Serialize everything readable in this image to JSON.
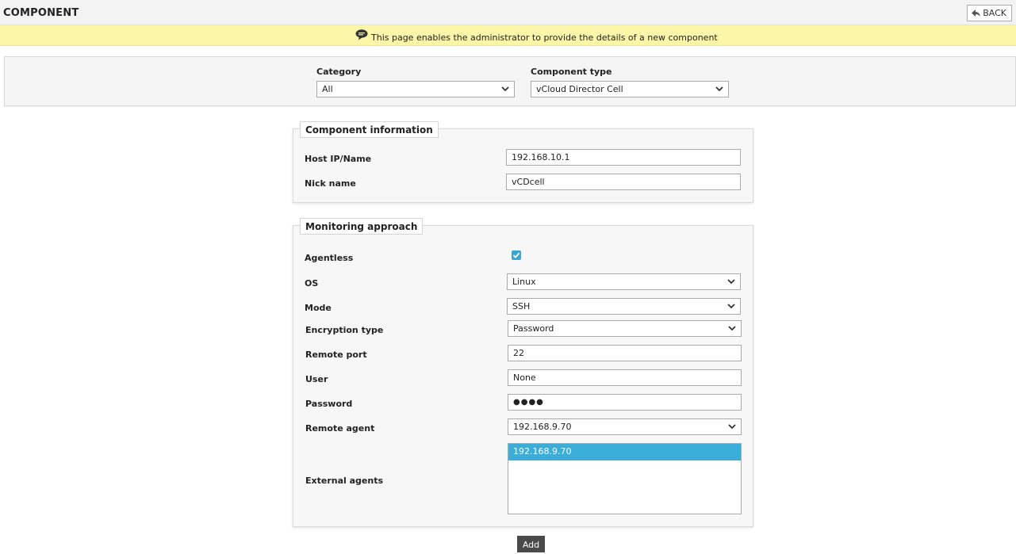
{
  "header": {
    "title": "COMPONENT",
    "back_label": "BACK"
  },
  "info": {
    "text": "This page enables the administrator to provide the details of a new component"
  },
  "filters": {
    "category_label": "Category",
    "category_value": "All",
    "component_type_label": "Component type",
    "component_type_value": "vCloud Director Cell"
  },
  "component_info": {
    "legend": "Component information",
    "host_label": "Host IP/Name",
    "host_value": "192.168.10.1",
    "nick_label": "Nick name",
    "nick_value": "vCDcell"
  },
  "monitoring": {
    "legend": "Monitoring approach",
    "agentless_label": "Agentless",
    "agentless_checked": true,
    "os_label": "OS",
    "os_value": "Linux",
    "mode_label": "Mode",
    "mode_value": "SSH",
    "encryption_label": "Encryption type",
    "encryption_value": "Password",
    "remote_port_label": "Remote port",
    "remote_port_value": "22",
    "user_label": "User",
    "user_value": "None",
    "password_label": "Password",
    "password_value": "●●●●",
    "remote_agent_label": "Remote agent",
    "remote_agent_value": "192.168.9.70",
    "external_agents_label": "External agents",
    "external_agents_options": [
      "192.168.9.70"
    ]
  },
  "actions": {
    "add_label": "Add"
  },
  "colors": {
    "info_bg": "#fcf7a8",
    "accent": "#3aa6d6",
    "add_button": "#4a4a4a"
  },
  "icons": {
    "back": "back-arrow-icon",
    "info": "speech-bubble-icon",
    "dropdown": "chevron-down-icon",
    "check": "check-icon"
  }
}
